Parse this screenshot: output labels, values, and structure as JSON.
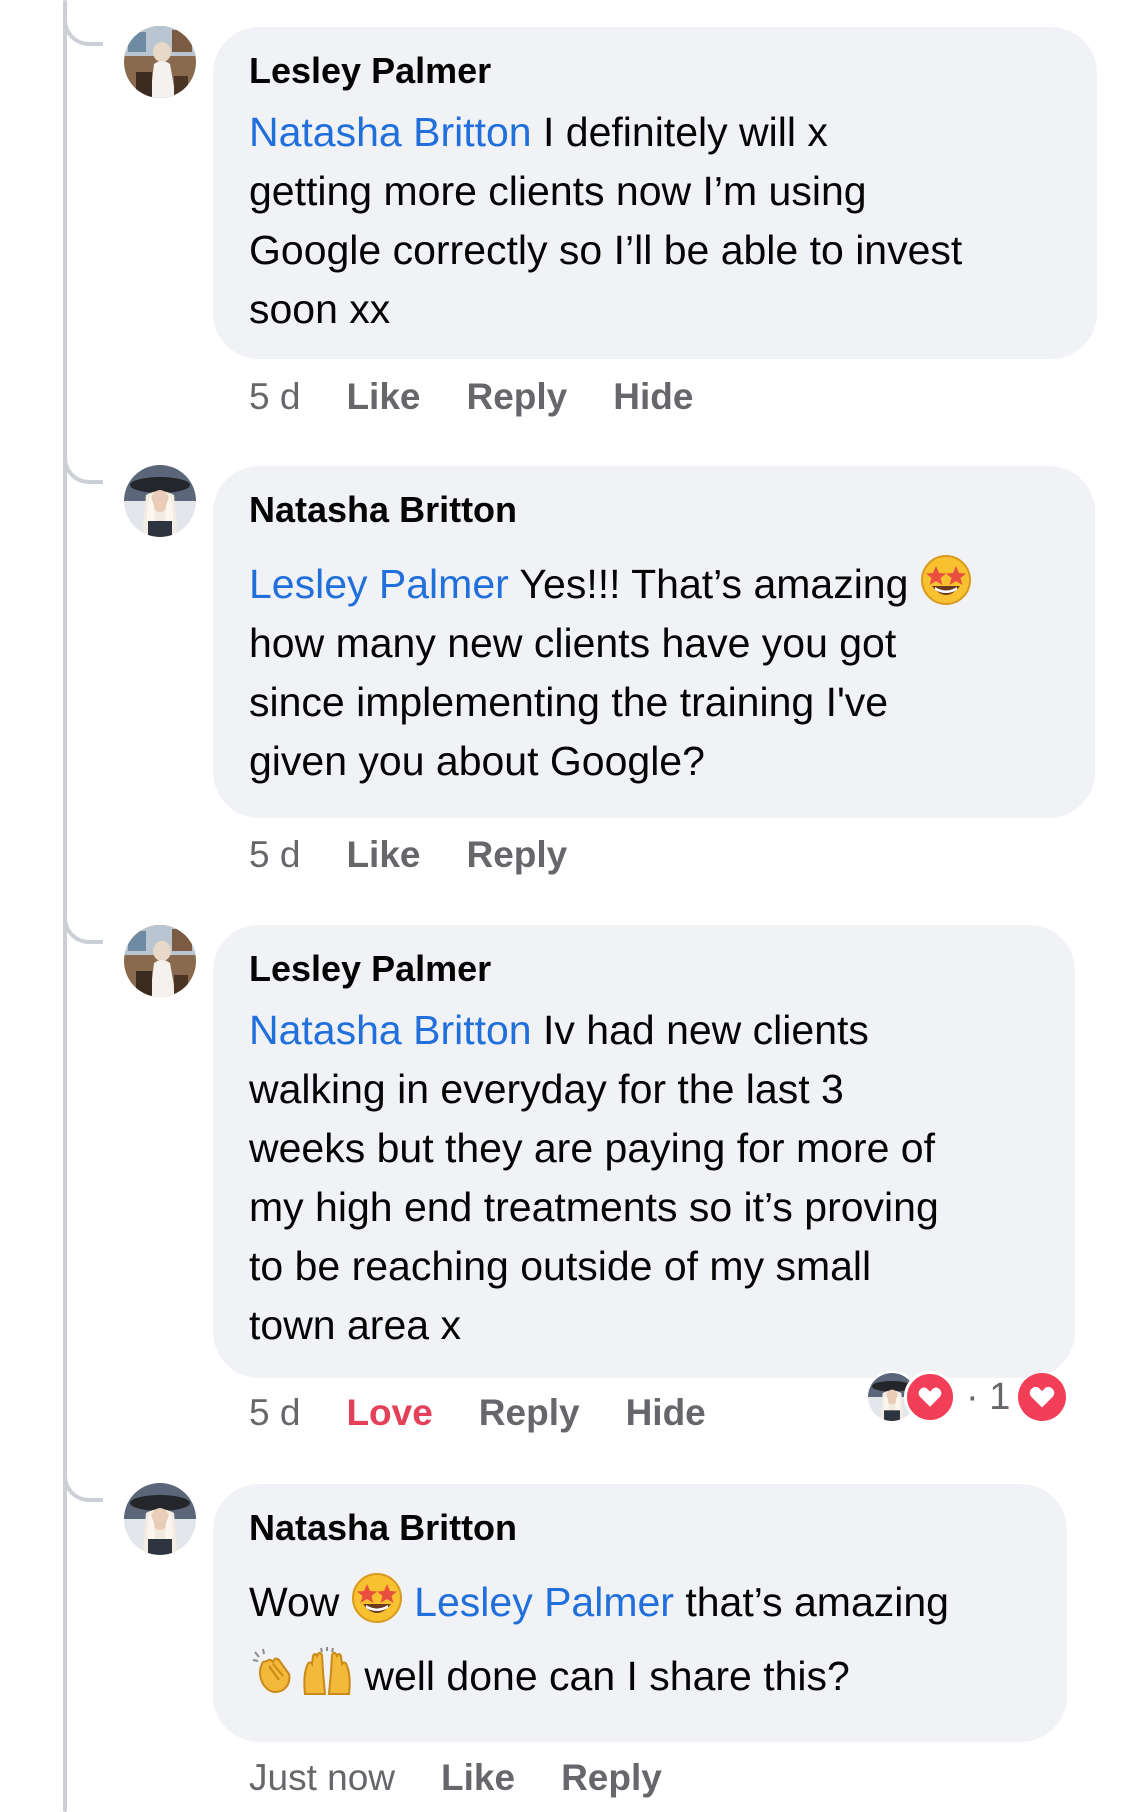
{
  "comments": [
    {
      "author": "Lesley Palmer",
      "mention": "Natasha Britton",
      "lines": [
        " I definitely will x",
        "getting more clients now I’m using",
        "Google correctly so I’ll be able to invest",
        "soon xx"
      ],
      "time": "5 d",
      "actions": [
        "Like",
        "Reply",
        "Hide"
      ]
    },
    {
      "author": "Natasha Britton",
      "mention": "Lesley Palmer",
      "first_line_text": " Yes!!! That’s amazing ",
      "first_line_emoji": "star-struck-emoji",
      "lines": [
        "how many new clients have you got",
        "since implementing the training I've",
        "given you about Google?"
      ],
      "time": "5 d",
      "actions": [
        "Like",
        "Reply"
      ]
    },
    {
      "author": "Lesley Palmer",
      "mention": "Natasha Britton",
      "lines": [
        " Iv had new clients",
        "walking in everyday for the last 3",
        "weeks  but they are paying for more of",
        "my high end treatments so it’s proving",
        "to be reaching outside of my small",
        "town area x"
      ],
      "time": "5 d",
      "reaction_label": "Love",
      "actions": [
        "Reply",
        "Hide"
      ],
      "reaction_separator": "·",
      "reaction_count": "1"
    },
    {
      "author": "Natasha Britton",
      "line1_prefix": "Wow ",
      "line1_emoji": "star-struck-emoji",
      "mention": "Lesley Palmer",
      "line1_suffix": " that’s amazing",
      "line2_emojis": [
        "clapping-hands-emoji",
        "raising-hands-emoji"
      ],
      "line2_text": " well done can I share this?",
      "time": "Just now",
      "actions": [
        "Like",
        "Reply"
      ]
    }
  ],
  "colors": {
    "bubble": "#f0f2f5",
    "mention": "#216fdb",
    "meta": "#65676b",
    "love": "#e4405a",
    "heart": "#f33e58",
    "thread": "#ccd0d5"
  }
}
